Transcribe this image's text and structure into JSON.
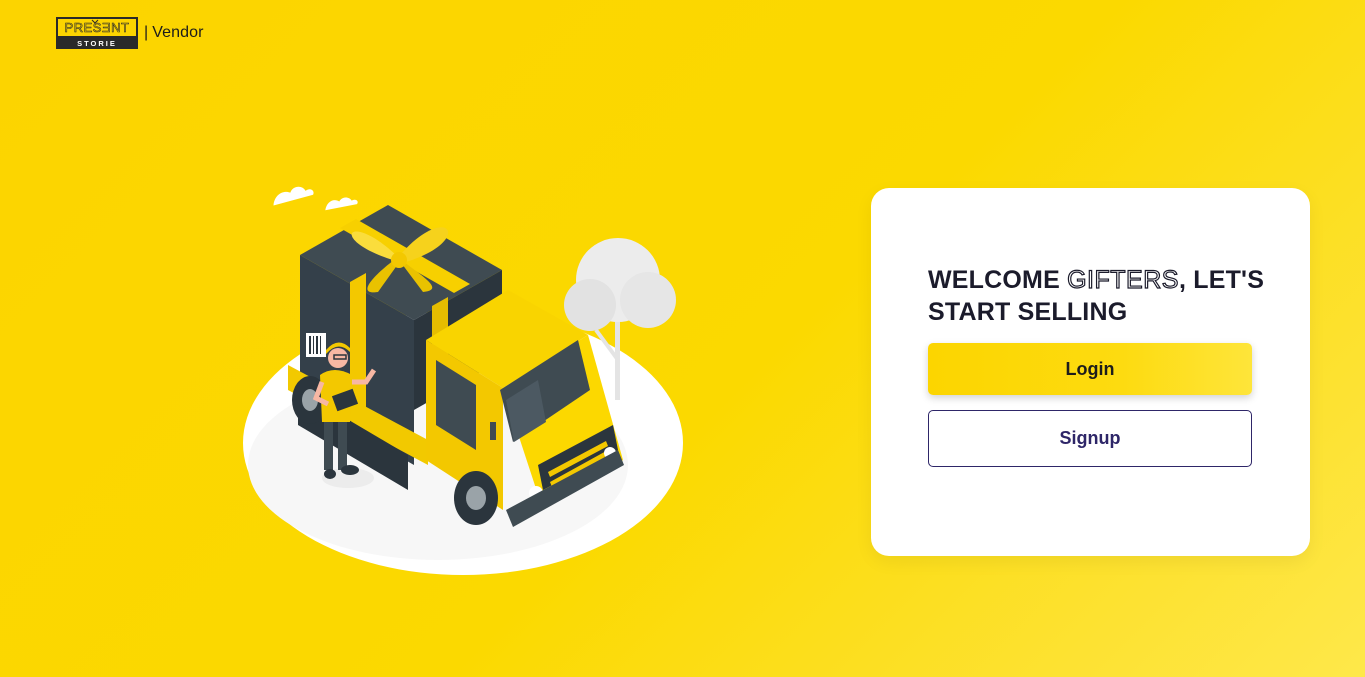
{
  "brand": {
    "logo_word_top": "PRESƎNT",
    "logo_word_bottom": "STORIE",
    "separator": "|",
    "portal_label": "Vendor"
  },
  "colors": {
    "background": "#fcd400",
    "card": "#ffffff",
    "text_dark": "#1b1b2b",
    "signup_accent": "#2e2668"
  },
  "welcome": {
    "prefix": "WELCOME ",
    "highlight": "GIFTERS",
    "suffix": ", LET'S START SELLING"
  },
  "actions": {
    "login_label": "Login",
    "signup_label": "Signup"
  },
  "illustration": {
    "icon": "delivery-truck-gift-illustration"
  }
}
